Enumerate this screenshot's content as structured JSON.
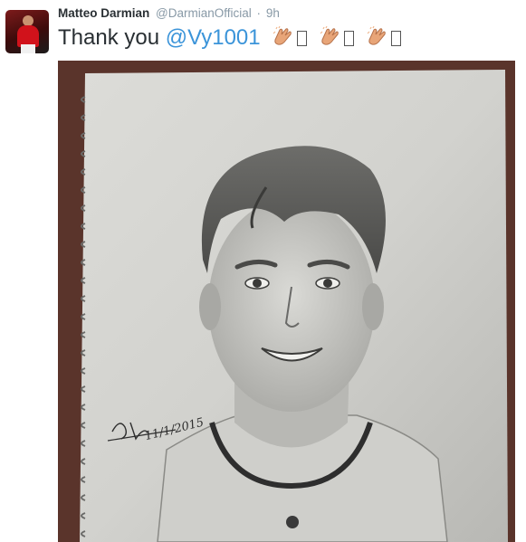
{
  "tweet": {
    "author_name": "Matteo Darmian",
    "author_handle": "@DarmianOfficial",
    "separator": "·",
    "timestamp": "9h",
    "text_prefix": "Thank you",
    "mention": "@Vy1001",
    "emoji": [
      "clapping-hands",
      "clapping-hands",
      "clapping-hands"
    ]
  },
  "photo": {
    "signature_date": "11/1/2015"
  },
  "colors": {
    "mention_link": "#3b94d9",
    "secondary_text": "#8899a6",
    "primary_text": "#292f33"
  }
}
